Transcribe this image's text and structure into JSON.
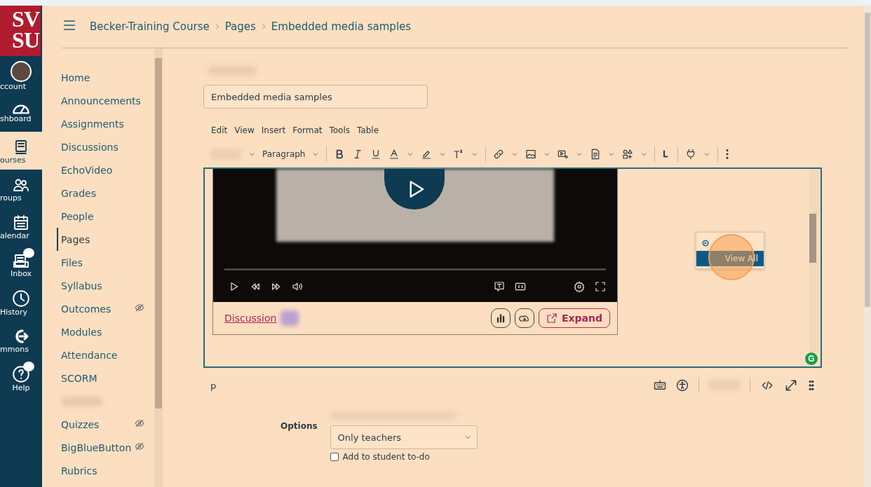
{
  "global_nav": {
    "logo": [
      "SV",
      "SU"
    ],
    "items": [
      {
        "label": "ccount",
        "selected": false,
        "badge": false
      },
      {
        "label": "shboard",
        "selected": false,
        "badge": false
      },
      {
        "label": "ourses",
        "selected": true,
        "badge": false
      },
      {
        "label": "roups",
        "selected": false,
        "badge": false
      },
      {
        "label": "alendar",
        "selected": false,
        "badge": false
      },
      {
        "label": "Inbox",
        "selected": false,
        "badge": true
      },
      {
        "label": "History",
        "selected": false,
        "badge": false
      },
      {
        "label": "mmons",
        "selected": false,
        "badge": false
      },
      {
        "label": "Help",
        "selected": false,
        "badge": true
      }
    ]
  },
  "breadcrumb": [
    "Becker-Training Course",
    "Pages",
    "Embedded media samples"
  ],
  "course_nav": [
    {
      "kind": "link",
      "label": "Home",
      "selected": false,
      "hidden": false
    },
    {
      "kind": "link",
      "label": "Announcements",
      "selected": false,
      "hidden": false
    },
    {
      "kind": "link",
      "label": "Assignments",
      "selected": false,
      "hidden": false
    },
    {
      "kind": "link",
      "label": "Discussions",
      "selected": false,
      "hidden": false
    },
    {
      "kind": "link",
      "label": "EchoVideo",
      "selected": false,
      "hidden": false
    },
    {
      "kind": "link",
      "label": "Grades",
      "selected": false,
      "hidden": false
    },
    {
      "kind": "link",
      "label": "People",
      "selected": false,
      "hidden": false
    },
    {
      "kind": "link",
      "label": "Pages",
      "selected": true,
      "hidden": false
    },
    {
      "kind": "link",
      "label": "Files",
      "selected": false,
      "hidden": false
    },
    {
      "kind": "link",
      "label": "Syllabus",
      "selected": false,
      "hidden": false
    },
    {
      "kind": "link",
      "label": "Outcomes",
      "selected": false,
      "hidden": true
    },
    {
      "kind": "link",
      "label": "Modules",
      "selected": false,
      "hidden": false
    },
    {
      "kind": "link",
      "label": "Attendance",
      "selected": false,
      "hidden": false
    },
    {
      "kind": "link",
      "label": "SCORM",
      "selected": false,
      "hidden": false
    },
    {
      "kind": "blurred"
    },
    {
      "kind": "link",
      "label": "Quizzes",
      "selected": false,
      "hidden": true
    },
    {
      "kind": "link",
      "label": "BigBlueButton",
      "selected": false,
      "hidden": true
    },
    {
      "kind": "link",
      "label": "Rubrics",
      "selected": false,
      "hidden": false
    }
  ],
  "editor": {
    "title_value": "Embedded media samples",
    "menu": [
      "Edit",
      "View",
      "Insert",
      "Format",
      "Tools",
      "Table"
    ],
    "block_format": "Paragraph",
    "plugin_menu": [
      {
        "kind": "icon",
        "selected": false
      },
      {
        "kind": "text",
        "label": "View All",
        "selected": true
      }
    ],
    "embed": {
      "link": "Discussion",
      "expand": "Expand"
    },
    "grammar_badge": "G",
    "status_path": "p"
  },
  "options": {
    "label": "Options",
    "select_value": "Only teachers",
    "checkbox": {
      "label": "Add to student to-do",
      "checked": false
    }
  }
}
